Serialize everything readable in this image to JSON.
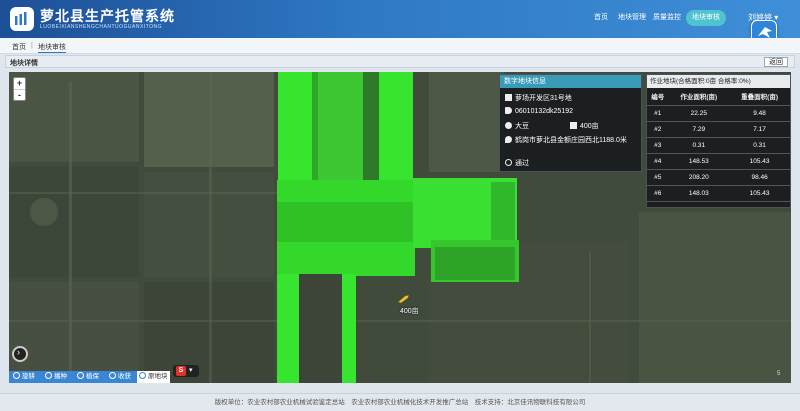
{
  "app": {
    "title": "萝北县生产托管系统",
    "subtitle": "LUOBEIXIANSHENGCHANTUOGUANXITONG"
  },
  "nav": {
    "items": [
      {
        "label": "首页"
      },
      {
        "label": "地块管理"
      },
      {
        "label": "质量监控"
      },
      {
        "label": "地块审核"
      }
    ],
    "user": "刘婷婷"
  },
  "breadcrumb": [
    "首页",
    "地块审核"
  ],
  "panel": {
    "title": "地块详情",
    "back_label": "返回"
  },
  "map": {
    "zoom_in": "+",
    "zoom_out": "-",
    "crop_label": "400亩",
    "corner_label": "5"
  },
  "legend": {
    "items": [
      "旋耕",
      "播种",
      "植保",
      "收获"
    ],
    "last": "原地块",
    "s_label": "S"
  },
  "field_info": {
    "title": "数字地块信息",
    "name": "萝场开发区31号地",
    "code": "06010132dk25192",
    "crop": "大豆",
    "area": "400亩",
    "location": "鹤岗市萝北县金额庄园西北1188.0米",
    "status": "通过"
  },
  "work_table": {
    "title": "作业地块(合格面积:0亩 合格率:0%)",
    "headers": [
      "编号",
      "作业面积(亩)",
      "重叠面积(亩)"
    ],
    "rows": [
      [
        "#1",
        "22.25",
        "9.48"
      ],
      [
        "#2",
        "7.29",
        "7.17"
      ],
      [
        "#3",
        "0.31",
        "0.31"
      ],
      [
        "#4",
        "148.53",
        "105.43"
      ],
      [
        "#5",
        "208.20",
        "98.46"
      ],
      [
        "#6",
        "148.03",
        "105.43"
      ]
    ]
  },
  "footer": "版权单位：农业农村部农业机械试验鉴定总站　农业农村部农业机械化技术开发推广总站　技术支持：北京佳讯物联科技有限公司"
}
